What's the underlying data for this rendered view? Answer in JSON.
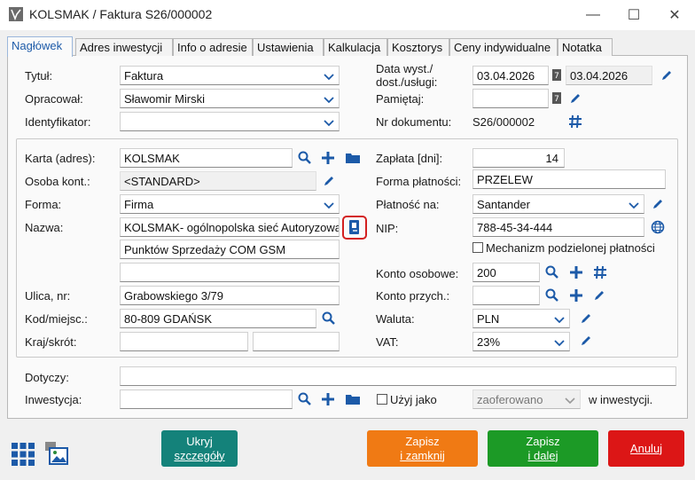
{
  "window": {
    "title": "KOLSMAK / Faktura S26/000002",
    "minimize": "—",
    "maximize": "☐",
    "close": "✕"
  },
  "tabs": [
    {
      "label": "Nagłówek"
    },
    {
      "label": "Adres inwestycji"
    },
    {
      "label": "Info o adresie"
    },
    {
      "label": "Ustawienia"
    },
    {
      "label": "Kalkulacja"
    },
    {
      "label": "Kosztorys"
    },
    {
      "label": "Ceny indywidualne"
    },
    {
      "label": "Notatka"
    }
  ],
  "header": {
    "tytul_label": "Tytuł:",
    "tytul_value": "Faktura",
    "opracowal_label": "Opracował:",
    "opracowal_value": "Sławomir Mirski",
    "identyfikator_label": "Identyfikator:",
    "identyfikator_value": "",
    "data_label_line1": "Data wyst./",
    "data_label_line2": "dost./usługi:",
    "data_wyst": "03.04.2026",
    "data_dost": "03.04.2026",
    "pamietaj_label": "Pamiętaj:",
    "pamietaj_value": "",
    "nr_dok_label": "Nr dokumentu:",
    "nr_dok_value": "S26/000002",
    "cal_glyph": "7"
  },
  "contractor": {
    "karta_label": "Karta (adres):",
    "karta_value": "KOLSMAK",
    "osoba_label": "Osoba kont.:",
    "osoba_value": "<STANDARD>",
    "forma_label": "Forma:",
    "forma_value": "Firma",
    "nazwa_label": "Nazwa:",
    "nazwa_line1": "KOLSMAK- ogólnopolska sieć Autoryzowanych",
    "nazwa_line2": "Punktów Sprzedaży COM GSM",
    "nazwa_line3": "",
    "ulica_label": "Ulica, nr:",
    "ulica_value": "Grabowskiego 3/79",
    "kod_label": "Kod/miejsc.:",
    "kod_value": "80-809 GDAŃSK",
    "kraj_label": "Kraj/skrót:",
    "kraj_value": "",
    "skrot_value": ""
  },
  "payment": {
    "zaplata_label": "Zapłata [dni]:",
    "zaplata_value": "14",
    "forma_platnosci_label": "Forma płatności:",
    "forma_platnosci_value": "PRZELEW",
    "platnosc_na_label": "Płatność na:",
    "platnosc_na_value": "Santander",
    "nip_label": "NIP:",
    "nip_value": "788-45-34-444",
    "mpp_label": "Mechanizm podzielonej płatności",
    "konto_osobowe_label": "Konto osobowe:",
    "konto_osobowe_value": "200",
    "konto_przych_label": "Konto przych.:",
    "konto_przych_value": "",
    "waluta_label": "Waluta:",
    "waluta_value": "PLN",
    "vat_label": "VAT:",
    "vat_value": "23%"
  },
  "bottom": {
    "dotyczy_label": "Dotyczy:",
    "dotyczy_value": "",
    "inwestycja_label": "Inwestycja:",
    "inwestycja_value": "",
    "uzyj_jako_label": "Użyj jako",
    "zaoferowano_value": "zaoferowano",
    "w_inwestycji_label": "w inwestycji."
  },
  "buttons": {
    "ukryj_line1": "Ukryj",
    "ukryj_line2": "szczegóły",
    "zapisz_zamknij_line1": "Zapisz",
    "zapisz_zamknij_line2": "i zamknij",
    "zapisz_dalej_line1": "Zapisz",
    "zapisz_dalej_line2": "i dalej",
    "anuluj": "Anuluj"
  },
  "colors": {
    "teal": "#14827a",
    "orange": "#f07a14",
    "green": "#1c9a26",
    "red": "#dc1616",
    "icon_blue": "#1c5aa8"
  }
}
